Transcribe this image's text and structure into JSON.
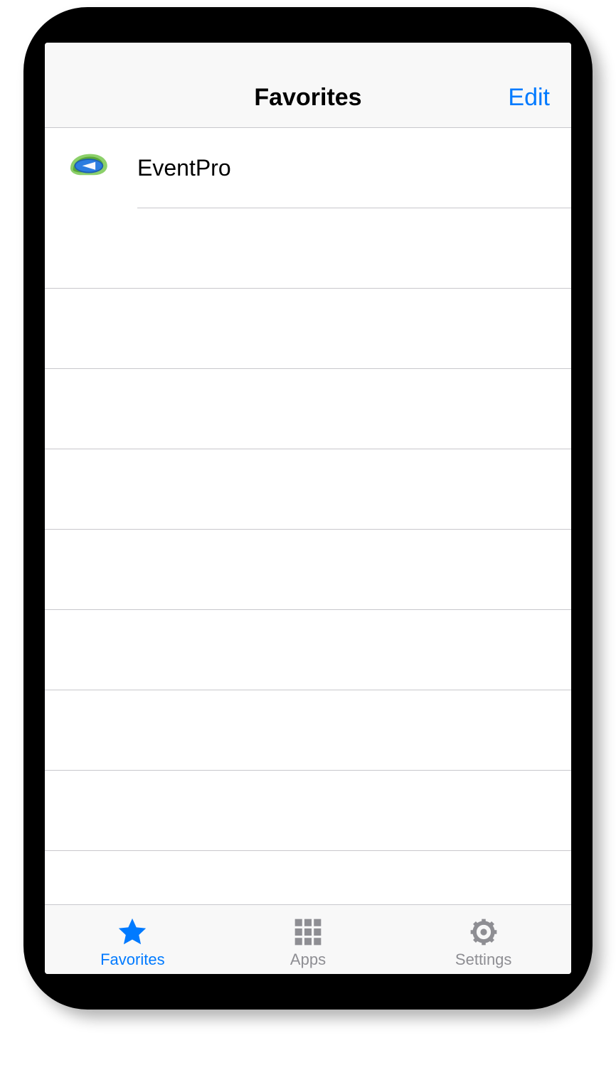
{
  "header": {
    "title": "Favorites",
    "edit_label": "Edit"
  },
  "favorites": {
    "items": [
      {
        "name": "EventPro",
        "icon": "eventpro-logo"
      }
    ]
  },
  "tabbar": {
    "items": [
      {
        "label": "Favorites",
        "icon": "star-icon",
        "active": true
      },
      {
        "label": "Apps",
        "icon": "grid-icon",
        "active": false
      },
      {
        "label": "Settings",
        "icon": "gear-icon",
        "active": false
      }
    ]
  },
  "colors": {
    "accent": "#007aff",
    "inactive": "#8e8e93",
    "separator": "#c8c7cc",
    "navbg": "#f8f8f8"
  }
}
